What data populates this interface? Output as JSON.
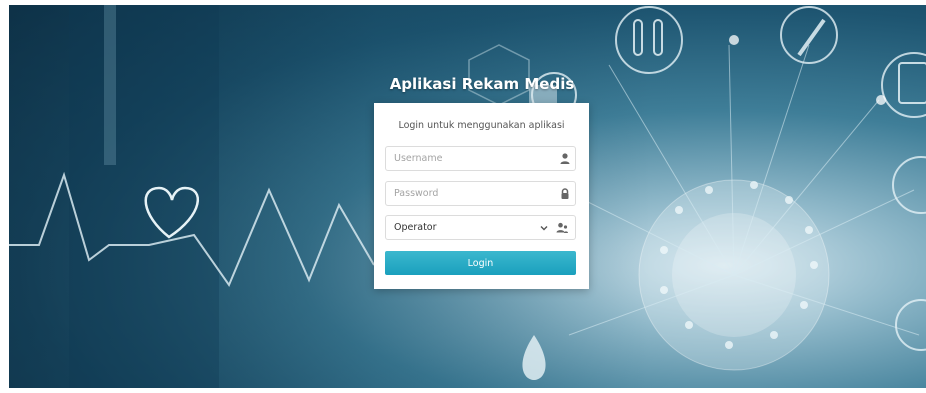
{
  "app": {
    "title": "Aplikasi Rekam Medis"
  },
  "login_form": {
    "subtitle": "Login untuk menggunakan aplikasi",
    "username_placeholder": "Username",
    "password_placeholder": "Password",
    "role_selected": "Operator",
    "login_label": "Login"
  },
  "icons": {
    "username": "user-icon",
    "password": "lock-icon",
    "role_dropdown": "chevron-down-icon",
    "role": "user-group-icon"
  },
  "colors": {
    "accent": "#1aa0bd",
    "background_dark": "#123d55",
    "panel": "#ffffff"
  }
}
